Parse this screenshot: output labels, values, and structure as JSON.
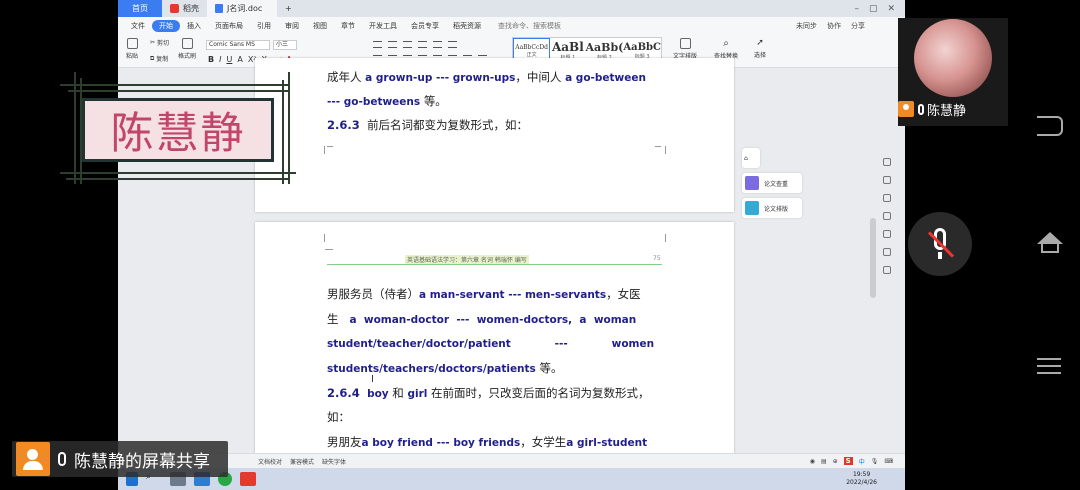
{
  "titlebar": {
    "home_tab": "首页",
    "tab_wps": "稻壳",
    "tab_doc": "J名词.doc",
    "add_tab": "+"
  },
  "menubar": {
    "items": [
      "文件",
      "开始",
      "插入",
      "页面布局",
      "引用",
      "审阅",
      "视图",
      "章节",
      "开发工具",
      "会员专享",
      "稻壳资源"
    ],
    "search": "查找命令、搜索模板",
    "unsync": "未同步",
    "collab": "协作",
    "share": "分享"
  },
  "ribbon": {
    "paste": "粘贴",
    "cut": "剪切",
    "copy": "复制",
    "format_painter": "格式刷",
    "font_name": "Comic Sans MS",
    "font_size": "小三",
    "styles": [
      {
        "preview": "AaBbCcDd",
        "label": "正文"
      },
      {
        "preview": "AaBl",
        "label": "标题 1"
      },
      {
        "preview": "AaBb(",
        "label": "标题 2"
      },
      {
        "preview": "AaBbC",
        "label": "标题 3"
      }
    ],
    "text_layout": "文字排版",
    "find_replace": "查找替换",
    "select": "选择"
  },
  "side_panel": {
    "paper_check": "论文查重",
    "paper_layout": "论文排版"
  },
  "doc": {
    "page1_line1_pre": "成年人",
    "page1_line1_a": "a grown-up --- grown-ups",
    "page1_line1_mid": "，中间人",
    "page1_line1_b": "a go-between",
    "page1_line2_b": "--- go-betweens",
    "page1_line2_post": "等。",
    "page1_heading_num": "2.6.3",
    "page1_heading_text": "前后名词都变为复数形式，如：",
    "page2_header": "英语基础语法学习：第六章  名词      韩瑞怀 编写",
    "page2_pageno": "75",
    "p2_l1_pre": "男服务员（侍者）",
    "p2_l1_b": "a man-servant --- men-servants",
    "p2_l1_post": "，女医",
    "p2_l2_pre": "生",
    "p2_l2_b": "a  woman-doctor  ---  women-doctors,  a  woman",
    "p2_l3_b": "student/teacher/doctor/patient            ---            women",
    "p2_l4_b": "students/teachers/doctors/patients",
    "p2_l4_post": "等。",
    "p2_h_num": "2.6.4",
    "p2_h_b1": "boy",
    "p2_h_mid": "和",
    "p2_h_b2": "girl",
    "p2_h_post": "在前面时，只改变后面的名词为复数形式，",
    "p2_l6": "如：",
    "p2_l7_pre": "男朋友",
    "p2_l7_b1": "a boy friend --- boy friends",
    "p2_l7_mid": "，女学生",
    "p2_l7_b2": "a girl-student"
  },
  "statusbar": {
    "doc_check": "文档校对",
    "read_mode": "兼容模式",
    "missing_font": "缺失字体",
    "ime": "S",
    "ime_lang": "中"
  },
  "taskbar": {
    "time": "19:59",
    "date": "2022/4/26"
  },
  "overlay": {
    "name_banner": "陈慧静",
    "share_label": "陈慧静的屏幕共享",
    "cam_name": "陈慧静"
  }
}
